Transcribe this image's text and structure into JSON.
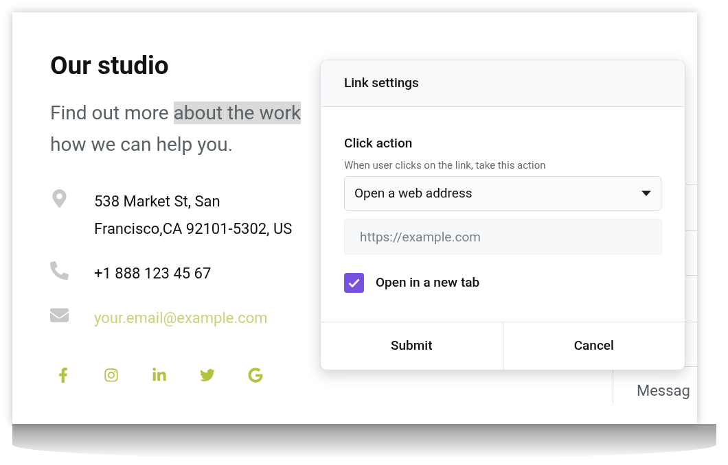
{
  "studio": {
    "title": "Our studio",
    "intro": {
      "first_line": [
        {
          "text": "Find out more ",
          "highlighted": false
        },
        {
          "text": "about the work",
          "highlighted": true
        }
      ],
      "second_line": "how we can help you."
    },
    "contacts": [
      {
        "kind": "address",
        "lines": [
          "538 Market St, San",
          "Francisco,CA 92101-5302, US"
        ]
      },
      {
        "kind": "phone",
        "lines": [
          "+1 888 123 45 67"
        ]
      },
      {
        "kind": "email",
        "lines": [
          "your.email@example.com"
        ]
      }
    ],
    "social": [
      {
        "kind": "facebook"
      },
      {
        "kind": "instagram"
      },
      {
        "kind": "linkedin"
      },
      {
        "kind": "twitter"
      },
      {
        "kind": "google"
      }
    ]
  },
  "contact_form": {
    "message_label": "Messag"
  },
  "dialog": {
    "title": "Link settings",
    "section_title": "Click action",
    "hint": "When user clicks on the link, take this action",
    "action_select": {
      "value": "Open a web address"
    },
    "url_field": {
      "placeholder": "https://example.com"
    },
    "new_tab": {
      "label": "Open in a new tab",
      "checked": true
    },
    "buttons": [
      "Submit",
      "Cancel"
    ]
  }
}
